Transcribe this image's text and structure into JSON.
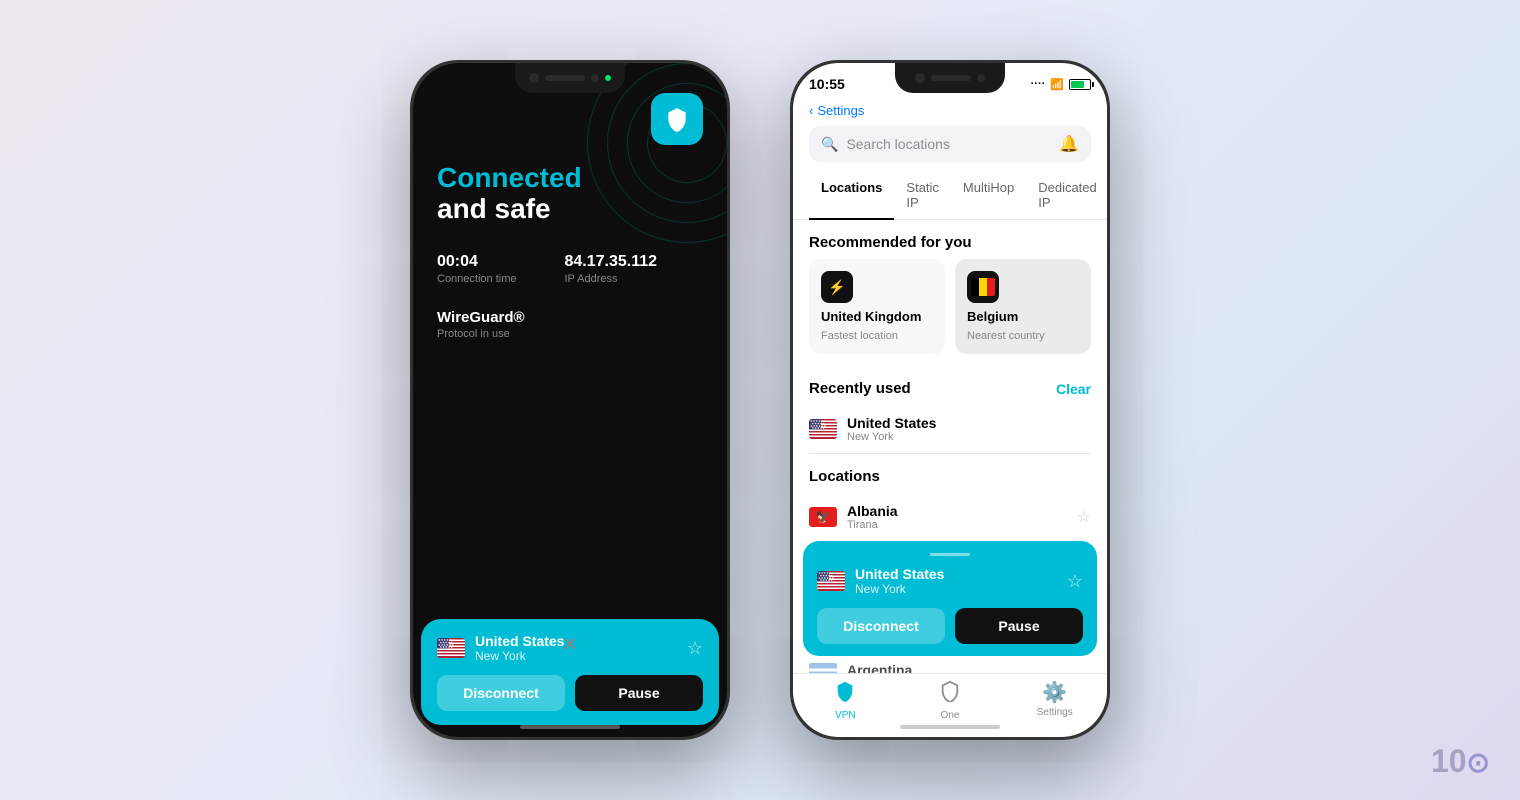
{
  "left_phone": {
    "notch": {
      "green_dot_visible": true
    },
    "status": {
      "label": "Connected",
      "subtitle": "and safe"
    },
    "stats": {
      "time_value": "00:04",
      "time_label": "Connection time",
      "ip_value": "84.17.35.112",
      "ip_label": "IP Address"
    },
    "protocol": {
      "name": "WireGuard®",
      "label": "Protocol in use"
    },
    "location": {
      "country": "United States",
      "city": "New York"
    },
    "buttons": {
      "disconnect": "Disconnect",
      "pause": "Pause"
    }
  },
  "right_phone": {
    "status_bar": {
      "time": "10:55",
      "back_label": "Settings"
    },
    "search": {
      "placeholder": "Search locations"
    },
    "tabs": [
      {
        "label": "Locations",
        "active": true
      },
      {
        "label": "Static IP",
        "active": false
      },
      {
        "label": "MultiHop",
        "active": false
      },
      {
        "label": "Dedicated IP",
        "active": false
      }
    ],
    "recommended": {
      "title": "Recommended for you",
      "items": [
        {
          "country": "United Kingdom",
          "sublabel": "Fastest location",
          "icon": "⚡"
        },
        {
          "country": "Belgium",
          "sublabel": "Nearest country",
          "flag": "BE"
        }
      ]
    },
    "recently_used": {
      "title": "Recently used",
      "clear_label": "Clear",
      "items": [
        {
          "country": "United States",
          "city": "New York",
          "flag": "US"
        }
      ]
    },
    "locations": {
      "title": "Locations",
      "items": [
        {
          "country": "Albania",
          "city": "Tirana",
          "flag": "AL"
        }
      ]
    },
    "active_location": {
      "country": "United States",
      "city": "New York",
      "flag": "US"
    },
    "active_buttons": {
      "disconnect": "Disconnect",
      "pause": "Pause"
    },
    "partially_visible": {
      "country": "Argentina",
      "flag": "AR"
    },
    "tab_bar": [
      {
        "label": "VPN",
        "icon": "shield",
        "active": true
      },
      {
        "label": "One",
        "icon": "shield-outline",
        "active": false
      },
      {
        "label": "Settings",
        "icon": "gear",
        "active": false
      }
    ]
  },
  "watermark": {
    "text": "10"
  }
}
